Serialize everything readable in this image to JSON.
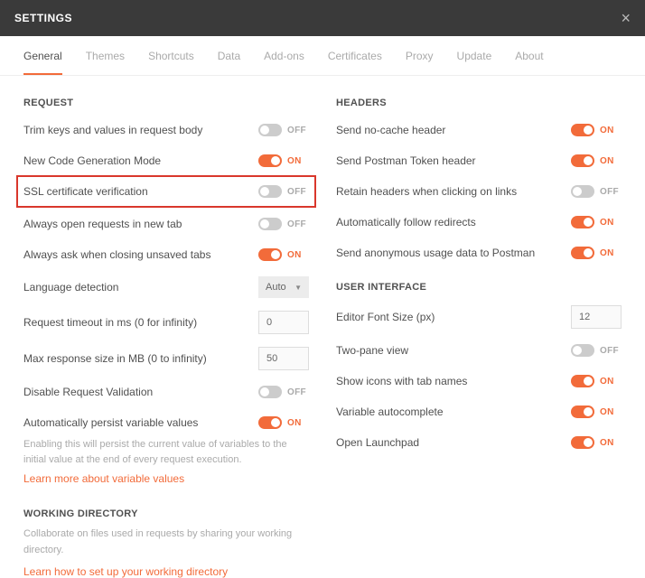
{
  "title": "SETTINGS",
  "tabs": [
    "General",
    "Themes",
    "Shortcuts",
    "Data",
    "Add-ons",
    "Certificates",
    "Proxy",
    "Update",
    "About"
  ],
  "activeTab": 0,
  "toggleText": {
    "on": "ON",
    "off": "OFF"
  },
  "left": {
    "requestTitle": "REQUEST",
    "trim": "Trim keys and values in request body",
    "codegen": "New Code Generation Mode",
    "ssl": "SSL certificate verification",
    "newtab": "Always open requests in new tab",
    "askclose": "Always ask when closing unsaved tabs",
    "langdet": "Language detection",
    "langdetValue": "Auto",
    "timeout": "Request timeout in ms (0 for infinity)",
    "timeoutValue": "0",
    "maxresp": "Max response size in MB (0 to infinity)",
    "maxrespValue": "50",
    "disableval": "Disable Request Validation",
    "persist": "Automatically persist variable values",
    "persistDesc": "Enabling this will persist the current value of variables to the initial value at the end of every request execution.",
    "persistLink": "Learn more about variable values",
    "workingDirTitle": "WORKING DIRECTORY",
    "workingDirDesc": "Collaborate on files used in requests by sharing your working directory.",
    "workingDirLink": "Learn how to set up your working directory"
  },
  "right": {
    "headersTitle": "HEADERS",
    "nocache": "Send no-cache header",
    "pmtoken": "Send Postman Token header",
    "retain": "Retain headers when clicking on links",
    "redirects": "Automatically follow redirects",
    "anon": "Send anonymous usage data to Postman",
    "uiTitle": "USER INTERFACE",
    "fontsize": "Editor Font Size (px)",
    "fontsizeValue": "12",
    "twopane": "Two-pane view",
    "tabicons": "Show icons with tab names",
    "varauto": "Variable autocomplete",
    "launchpad": "Open Launchpad"
  }
}
